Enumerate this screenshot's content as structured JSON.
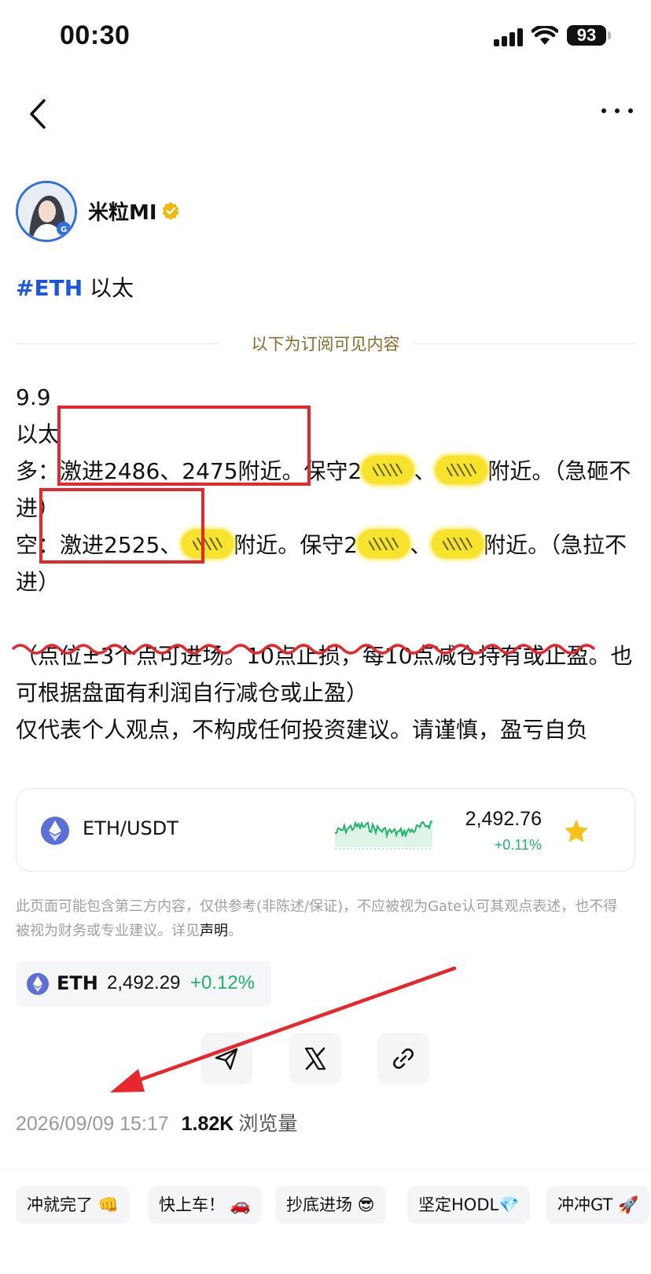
{
  "status_bar": {
    "time": "00:30",
    "battery": "93"
  },
  "nav": {
    "back_icon": "chevron-left-icon",
    "more_icon": "ellipsis-icon"
  },
  "author": {
    "name": "米粒MI",
    "verified_icon": "verified-badge-icon",
    "verified_color": "#f0b90b"
  },
  "post": {
    "hashtag": "#ETH",
    "topic": "以太",
    "divider_text": "以下为订阅可见内容",
    "line1": "9.9",
    "line2": "以太",
    "long_prefix": "多：激进2486、2475附近。保守2",
    "long_mid": "、",
    "long_suffix": "附近。（急砸不进）",
    "short_prefix": "空：激进2525、",
    "short_mid": "附近。保守2",
    "short_mid2": "、",
    "short_suffix": "附近。（急拉不进）",
    "note": "（点位±3个点可进场。10点止损，每10点减仓持有或止盈。也可根据盘面有利润自行减仓或止盈）",
    "disclaimer": "仅代表个人观点，不构成任何投资建议。请谨慎，盈亏自负"
  },
  "market_card": {
    "pair": "ETH/USDT",
    "price": "2,492.76",
    "change": "+0.11%",
    "star_icon": "star-icon",
    "accent_positive": "#1fb36b"
  },
  "disclaimer": {
    "text": "此页面可能包含第三方内容，仅供参考(非陈述/保证)，不应被视为Gate认可其观点表述，也不得被视为财务或专业建议。详见",
    "link": "声明",
    "end": "。"
  },
  "ticker": {
    "symbol": "ETH",
    "price": "2,492.29",
    "change": "+0.12%"
  },
  "share": {
    "icons": [
      "send-icon",
      "x-logo-icon",
      "link-icon"
    ]
  },
  "meta": {
    "date": "2026/09/09 15:17",
    "views": "1.82K",
    "views_label": "浏览量"
  },
  "reactions": [
    "冲就完了 👊",
    "快上车！ 🚗",
    "抄底进场 😎",
    "坚定HODL💎",
    "冲冲GT 🚀"
  ]
}
